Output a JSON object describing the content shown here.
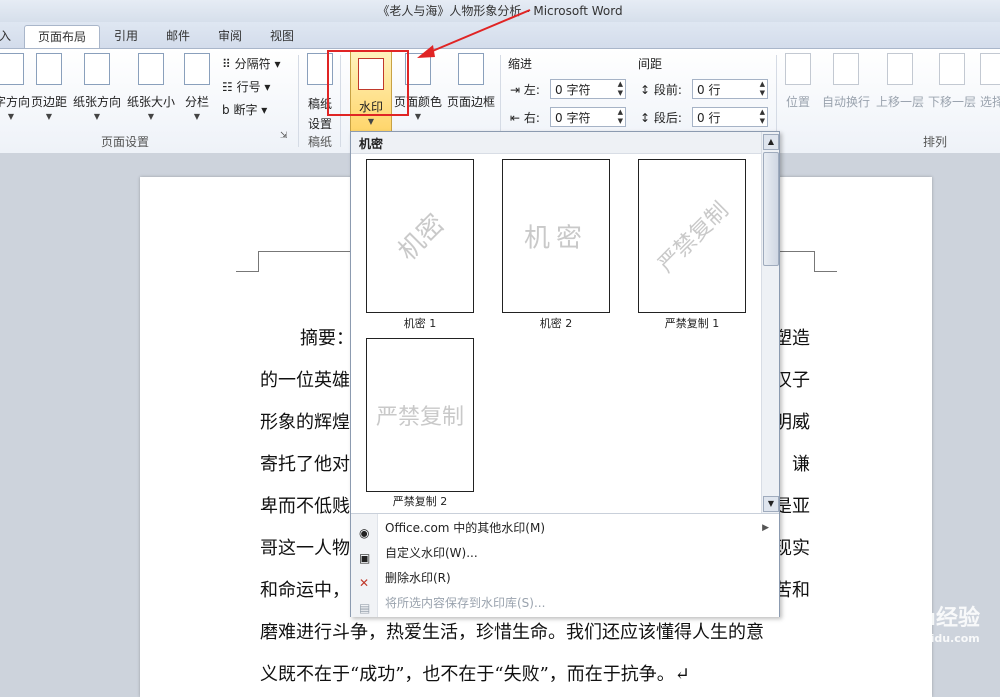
{
  "window": {
    "title": "《老人与海》人物形象分析 - Microsoft Word"
  },
  "tabs": [
    "入",
    "页面布局",
    "引用",
    "邮件",
    "审阅",
    "视图"
  ],
  "active_tab": "页面布局",
  "ribbon": {
    "page_setup": {
      "label": "页面设置",
      "buttons": [
        "字方向",
        "页边距",
        "纸张方向",
        "纸张大小",
        "分栏"
      ],
      "small": [
        "分隔符",
        "行号",
        "断字"
      ]
    },
    "manuscript": {
      "label": "稿纸",
      "button_line1": "稿纸",
      "button_line2": "设置"
    },
    "page_background": {
      "watermark": "水印",
      "page_color": "页面颜色",
      "page_border": "页面边框"
    },
    "paragraph": {
      "indent_title": "缩进",
      "indent_left_label": "左:",
      "indent_left_value": "0 字符",
      "indent_right_label": "右:",
      "indent_right_value": "0 字符",
      "spacing_title": "间距",
      "spacing_before_label": "段前:",
      "spacing_before_value": "0 行",
      "spacing_after_label": "段后:",
      "spacing_after_value": "0 行"
    },
    "arrange": {
      "label": "排列",
      "buttons": [
        "位置",
        "自动换行",
        "上移一层",
        "下移一层",
        "选择"
      ]
    }
  },
  "gallery": {
    "section_title": "机密",
    "items": [
      {
        "caption": "机密 1",
        "watermark": "机密"
      },
      {
        "caption": "机密 2",
        "watermark": "机密"
      },
      {
        "caption": "严禁复制 1",
        "watermark": "严禁复制"
      },
      {
        "caption": "严禁复制 2",
        "watermark": "严禁复制"
      }
    ],
    "menu": [
      {
        "label": "Office.com 中的其他水印(M)",
        "enabled": true,
        "submenu": true
      },
      {
        "label": "自定义水印(W)...",
        "enabled": true,
        "submenu": false
      },
      {
        "label": "删除水印(R)",
        "enabled": true,
        "submenu": false
      },
      {
        "label": "将所选内容保存到水印库(S)...",
        "enabled": false,
        "submenu": false
      }
    ]
  },
  "document": {
    "lines_left": [
      "摘要：",
      "的一位英雄",
      "形象的辉煌",
      "寄托了他对",
      "卑而不低贱",
      "哥这一人物",
      "和命运中，",
      "磨难进行斗争，热爱生活，珍惜生命。我们还应该懂得人生的意",
      "义既不在于“成功”，也不在于“失败”，而在于抗争。↵"
    ],
    "lines_right": [
      "塑造",
      "汉子",
      "明威",
      "，谦",
      "是亚",
      "现实",
      "苦和"
    ]
  },
  "site_watermark": {
    "name": "Baidu经验",
    "url": "jingyan.baidu.com"
  },
  "colors": {
    "highlight": "#e02424",
    "accent": "#ffd56a"
  }
}
